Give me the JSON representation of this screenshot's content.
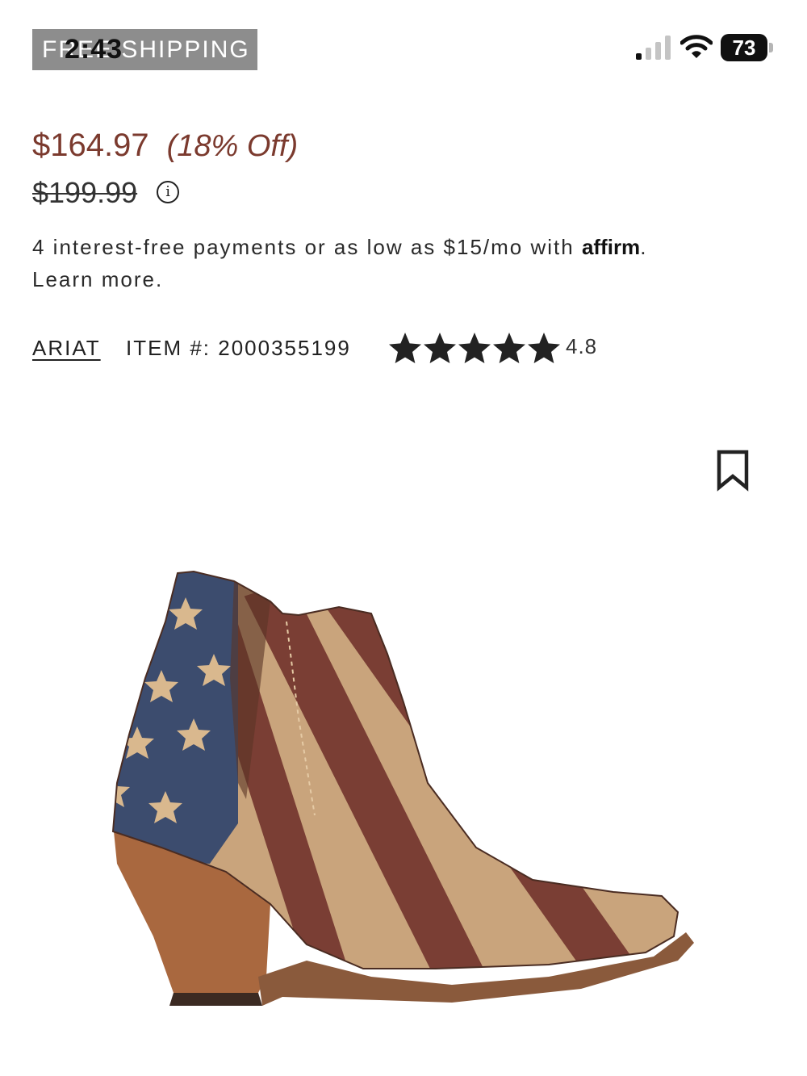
{
  "status_bar": {
    "promo": "FREE SHIPPING",
    "time": "2:43",
    "battery": "73"
  },
  "pricing": {
    "sale_price": "$164.97",
    "discount": "(18% Off)",
    "original_price": "$199.99",
    "info_glyph": "i"
  },
  "financing": {
    "text": "4 interest-free payments or as low as $15/mo with ",
    "provider": "affirm",
    "suffix": ".",
    "learn_more": "Learn more."
  },
  "meta": {
    "brand": "ARIAT",
    "item_number": "ITEM #: 2000355199",
    "rating": "4.8",
    "rating_value": 4.8,
    "rating_max": 5
  },
  "icons": {
    "bookmark": "bookmark-icon",
    "info": "info-icon",
    "signal": "signal-icon",
    "wifi": "wifi-icon",
    "battery": "battery-icon",
    "star": "star-icon"
  },
  "colors": {
    "price": "#7b3a2e",
    "text": "#2a2a2a",
    "promo_bg": "#8d8d8d"
  }
}
